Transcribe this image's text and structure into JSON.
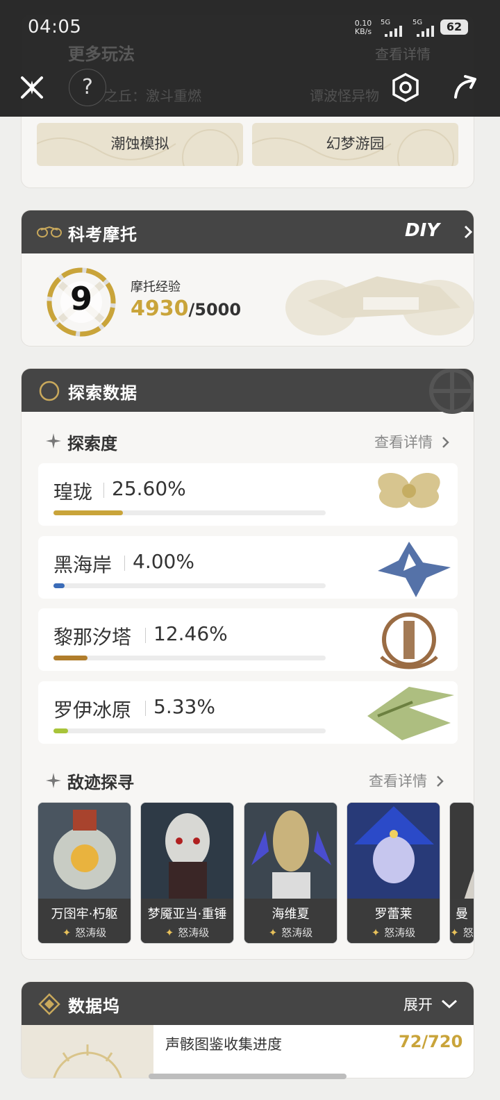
{
  "status": {
    "time": "04:05",
    "net_speed": "0.10",
    "net_unit": "KB/s",
    "sig1": "5G",
    "sig2": "5G",
    "battery": "62"
  },
  "more_play": {
    "title": "更多玩法",
    "link": "查看详情",
    "btn_top_left": "之丘：激斗重燃",
    "btn_top_right": "谭波怪异物",
    "btn_left": "潮蚀模拟",
    "btn_right": "幻梦游园"
  },
  "moto": {
    "title": "科考摩托",
    "diy": "DIY",
    "level": "9",
    "exp_label": "摩托经验",
    "exp_current": "4930",
    "exp_max": "/5000",
    "exp_ratio": 0.986
  },
  "explore": {
    "title": "探索数据",
    "degree_title": "探索度",
    "degree_link": "查看详情",
    "regions": [
      {
        "name": "瑝珑",
        "percent": "25.60%",
        "value": 25.6,
        "color": "#c9a43a"
      },
      {
        "name": "黑海岸",
        "percent": "4.00%",
        "value": 4.0,
        "color": "#3b6cb8"
      },
      {
        "name": "黎那汐塔",
        "percent": "12.46%",
        "value": 12.46,
        "color": "#b07d2b"
      },
      {
        "name": "罗伊冰原",
        "percent": "5.33%",
        "value": 5.33,
        "color": "#a8c43a"
      }
    ],
    "enemy_title": "敌迹探寻",
    "enemy_link": "查看详情",
    "enemies": [
      {
        "name": "万囹牢·朽躯",
        "level": "怒涛级"
      },
      {
        "name": "梦魇亚当·重锤",
        "level": "怒涛级"
      },
      {
        "name": "海维夏",
        "level": "怒涛级"
      },
      {
        "name": "罗蕾莱",
        "level": "怒涛级"
      },
      {
        "name": "曼",
        "level": "怒"
      }
    ]
  },
  "dock": {
    "title": "数据坞",
    "expand": "展开",
    "collect_label": "声骸图鉴收集进度",
    "collect_value": "72/720"
  }
}
